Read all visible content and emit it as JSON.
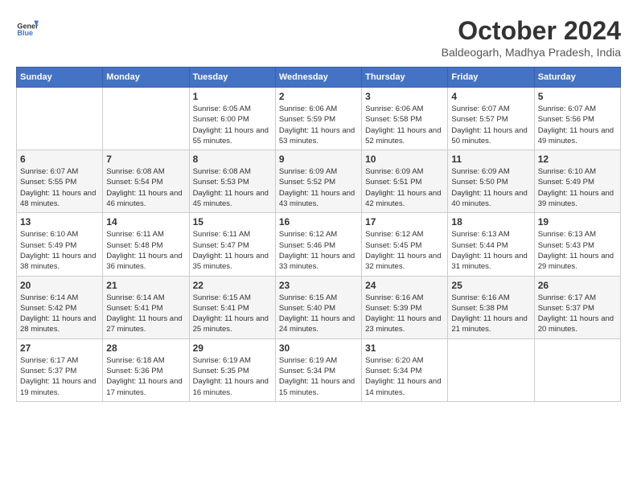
{
  "header": {
    "logo_line1": "General",
    "logo_line2": "Blue",
    "main_title": "October 2024",
    "subtitle": "Baldeogarh, Madhya Pradesh, India"
  },
  "days_of_week": [
    "Sunday",
    "Monday",
    "Tuesday",
    "Wednesday",
    "Thursday",
    "Friday",
    "Saturday"
  ],
  "weeks": [
    [
      {
        "day": "",
        "info": ""
      },
      {
        "day": "",
        "info": ""
      },
      {
        "day": "1",
        "info": "Sunrise: 6:05 AM\nSunset: 6:00 PM\nDaylight: 11 hours and 55 minutes."
      },
      {
        "day": "2",
        "info": "Sunrise: 6:06 AM\nSunset: 5:59 PM\nDaylight: 11 hours and 53 minutes."
      },
      {
        "day": "3",
        "info": "Sunrise: 6:06 AM\nSunset: 5:58 PM\nDaylight: 11 hours and 52 minutes."
      },
      {
        "day": "4",
        "info": "Sunrise: 6:07 AM\nSunset: 5:57 PM\nDaylight: 11 hours and 50 minutes."
      },
      {
        "day": "5",
        "info": "Sunrise: 6:07 AM\nSunset: 5:56 PM\nDaylight: 11 hours and 49 minutes."
      }
    ],
    [
      {
        "day": "6",
        "info": "Sunrise: 6:07 AM\nSunset: 5:55 PM\nDaylight: 11 hours and 48 minutes."
      },
      {
        "day": "7",
        "info": "Sunrise: 6:08 AM\nSunset: 5:54 PM\nDaylight: 11 hours and 46 minutes."
      },
      {
        "day": "8",
        "info": "Sunrise: 6:08 AM\nSunset: 5:53 PM\nDaylight: 11 hours and 45 minutes."
      },
      {
        "day": "9",
        "info": "Sunrise: 6:09 AM\nSunset: 5:52 PM\nDaylight: 11 hours and 43 minutes."
      },
      {
        "day": "10",
        "info": "Sunrise: 6:09 AM\nSunset: 5:51 PM\nDaylight: 11 hours and 42 minutes."
      },
      {
        "day": "11",
        "info": "Sunrise: 6:09 AM\nSunset: 5:50 PM\nDaylight: 11 hours and 40 minutes."
      },
      {
        "day": "12",
        "info": "Sunrise: 6:10 AM\nSunset: 5:49 PM\nDaylight: 11 hours and 39 minutes."
      }
    ],
    [
      {
        "day": "13",
        "info": "Sunrise: 6:10 AM\nSunset: 5:49 PM\nDaylight: 11 hours and 38 minutes."
      },
      {
        "day": "14",
        "info": "Sunrise: 6:11 AM\nSunset: 5:48 PM\nDaylight: 11 hours and 36 minutes."
      },
      {
        "day": "15",
        "info": "Sunrise: 6:11 AM\nSunset: 5:47 PM\nDaylight: 11 hours and 35 minutes."
      },
      {
        "day": "16",
        "info": "Sunrise: 6:12 AM\nSunset: 5:46 PM\nDaylight: 11 hours and 33 minutes."
      },
      {
        "day": "17",
        "info": "Sunrise: 6:12 AM\nSunset: 5:45 PM\nDaylight: 11 hours and 32 minutes."
      },
      {
        "day": "18",
        "info": "Sunrise: 6:13 AM\nSunset: 5:44 PM\nDaylight: 11 hours and 31 minutes."
      },
      {
        "day": "19",
        "info": "Sunrise: 6:13 AM\nSunset: 5:43 PM\nDaylight: 11 hours and 29 minutes."
      }
    ],
    [
      {
        "day": "20",
        "info": "Sunrise: 6:14 AM\nSunset: 5:42 PM\nDaylight: 11 hours and 28 minutes."
      },
      {
        "day": "21",
        "info": "Sunrise: 6:14 AM\nSunset: 5:41 PM\nDaylight: 11 hours and 27 minutes."
      },
      {
        "day": "22",
        "info": "Sunrise: 6:15 AM\nSunset: 5:41 PM\nDaylight: 11 hours and 25 minutes."
      },
      {
        "day": "23",
        "info": "Sunrise: 6:15 AM\nSunset: 5:40 PM\nDaylight: 11 hours and 24 minutes."
      },
      {
        "day": "24",
        "info": "Sunrise: 6:16 AM\nSunset: 5:39 PM\nDaylight: 11 hours and 23 minutes."
      },
      {
        "day": "25",
        "info": "Sunrise: 6:16 AM\nSunset: 5:38 PM\nDaylight: 11 hours and 21 minutes."
      },
      {
        "day": "26",
        "info": "Sunrise: 6:17 AM\nSunset: 5:37 PM\nDaylight: 11 hours and 20 minutes."
      }
    ],
    [
      {
        "day": "27",
        "info": "Sunrise: 6:17 AM\nSunset: 5:37 PM\nDaylight: 11 hours and 19 minutes."
      },
      {
        "day": "28",
        "info": "Sunrise: 6:18 AM\nSunset: 5:36 PM\nDaylight: 11 hours and 17 minutes."
      },
      {
        "day": "29",
        "info": "Sunrise: 6:19 AM\nSunset: 5:35 PM\nDaylight: 11 hours and 16 minutes."
      },
      {
        "day": "30",
        "info": "Sunrise: 6:19 AM\nSunset: 5:34 PM\nDaylight: 11 hours and 15 minutes."
      },
      {
        "day": "31",
        "info": "Sunrise: 6:20 AM\nSunset: 5:34 PM\nDaylight: 11 hours and 14 minutes."
      },
      {
        "day": "",
        "info": ""
      },
      {
        "day": "",
        "info": ""
      }
    ]
  ]
}
